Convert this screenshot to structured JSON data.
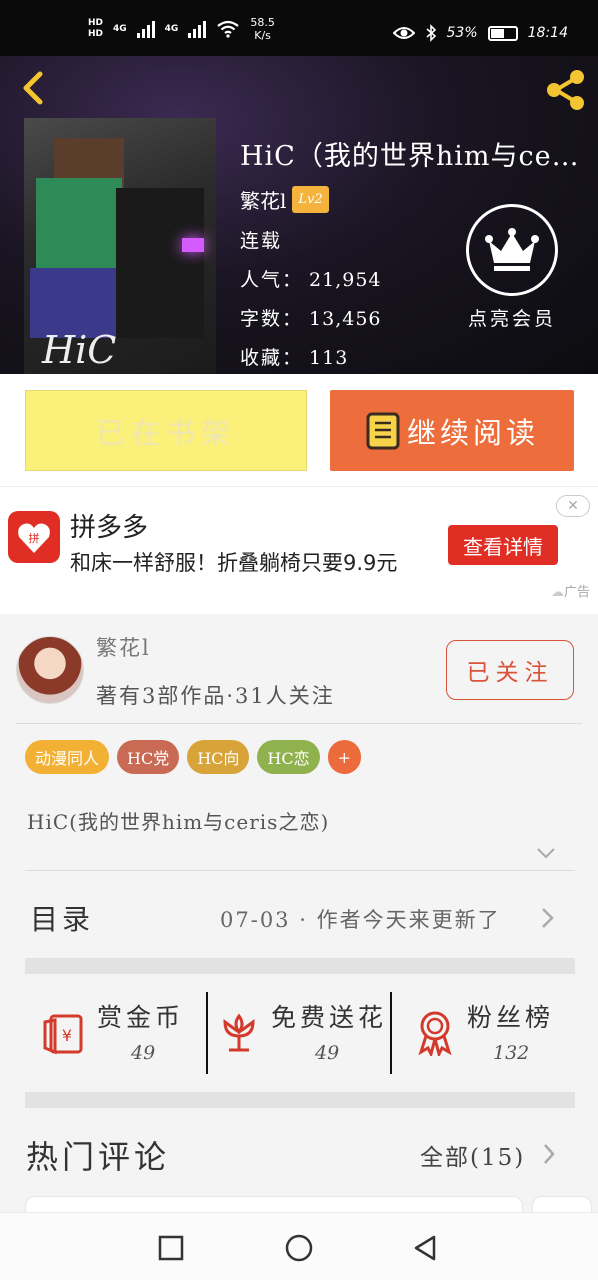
{
  "status_bar": {
    "hd1": "HD",
    "hd2": "HD",
    "net1": "4G",
    "net2": "4G",
    "speed_value": "58.5",
    "speed_unit": "K/s",
    "battery": "53%",
    "battery_level": 0.53,
    "time": "18:14"
  },
  "book": {
    "title": "HiC（我的世界him与ceris之恋）",
    "author": "繁花l",
    "level": "Lv2",
    "status": "连载",
    "popularity_label": "人气：",
    "popularity": "21,954",
    "words_label": "字数：",
    "words": "13,456",
    "favorites_label": "收藏：",
    "favorites": "113",
    "cover_signature": "HiC",
    "vip_label": "点亮会员"
  },
  "actions": {
    "shelf_label": "已在书架",
    "read_label": "继续阅读"
  },
  "ad": {
    "brand": "拼多多",
    "logo_text": "拼",
    "text": "和床一样舒服！折叠躺椅只要9.9元",
    "cta": "查看详情",
    "close": "✕",
    "tag": "广告"
  },
  "author_section": {
    "name": "繁花l",
    "stats": "著有3部作品·31人关注",
    "follow_label": "已关注",
    "tags": [
      {
        "label": "动漫同人",
        "color": "#f2b134"
      },
      {
        "label": "HC党",
        "color": "#c96a55"
      },
      {
        "label": "HC向",
        "color": "#d8a338"
      },
      {
        "label": "HC恋",
        "color": "#8fb24f"
      },
      {
        "label": "+",
        "color": "#ec6b3c"
      }
    ],
    "description": "HiC(我的世界him与ceris之恋)",
    "toc_label": "目录",
    "toc_latest": "07-03 · 作者今天来更新了"
  },
  "rewards": [
    {
      "label": "赏金币",
      "value": "49",
      "icon": "red-envelope-icon"
    },
    {
      "label": "免费送花",
      "value": "49",
      "icon": "flower-icon"
    },
    {
      "label": "粉丝榜",
      "value": "132",
      "icon": "medal-icon"
    }
  ],
  "comments": {
    "label": "热门评论",
    "all_label": "全部(15)"
  },
  "colors": {
    "accent_orange": "#ed6d3c",
    "shelf_yellow": "#fbf07a",
    "follow_red": "#d9533b",
    "ad_red": "#e02e24"
  }
}
